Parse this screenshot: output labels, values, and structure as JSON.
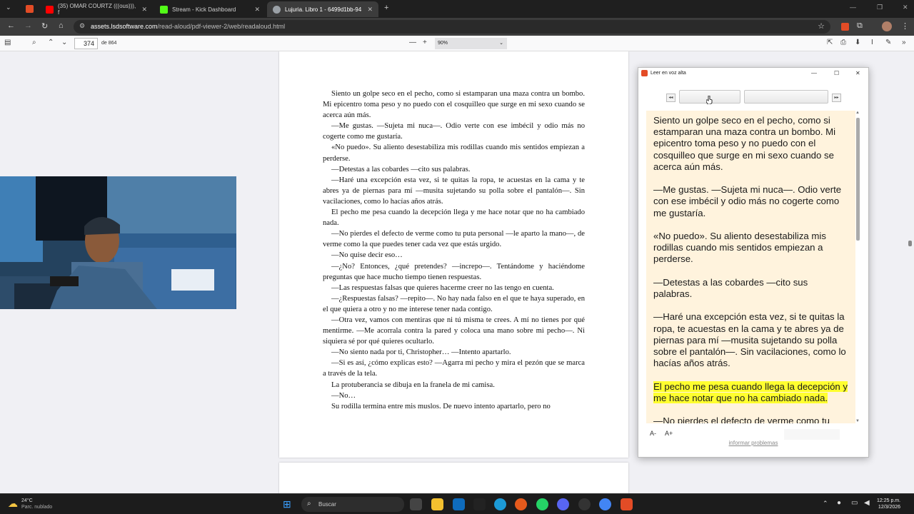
{
  "tabs": [
    {
      "label": "(35) OMAR COURTZ (((ous))), f",
      "color": "#ff0000"
    },
    {
      "label": "Stream - Kick Dashboard",
      "color": "#53fc18"
    },
    {
      "label": "Lujuria. Libro 1 - 6499d1bb-94",
      "color": "#9aa0a6"
    }
  ],
  "address": {
    "host": "assets.lsdsoftware.com",
    "path": "/read-aloud/pdf-viewer-2/web/readaloud.html"
  },
  "pdf_toolbar": {
    "page": "374",
    "page_count": "de 864",
    "zoom": "90%"
  },
  "page_paragraphs": [
    "Siento un golpe seco en el pecho, como si estamparan una maza contra un bombo. Mi epicentro toma peso y no puedo con el cosquilleo que surge en mi sexo cuando se acerca aún más.",
    "—Me gustas. —Sujeta mi nuca—. Odio verte con ese imbécil y odio más no cogerte como me gustaría.",
    "«No puedo». Su aliento desestabiliza mis rodillas cuando mis sentidos empiezan a perderse.",
    "—Detestas a las cobardes —cito sus palabras.",
    "—Haré una excepción esta vez, si te quitas la ropa, te acuestas en la cama y te abres ya de piernas para mí —musita sujetando su polla sobre el pantalón—. Sin vacilaciones, como lo hacías años atrás.",
    "El pecho me pesa cuando la decepción llega y me hace notar que no ha cambiado nada.",
    "—No pierdes el defecto de verme como tu puta personal —le aparto la mano—, de verme como la que puedes tener cada vez que estás urgido.",
    "—No quise decir eso…",
    "—¿No? Entonces, ¿qué pretendes? —increpo—. Tentándome y haciéndome preguntas que hace mucho tiempo tienen respuestas.",
    "—Las respuestas falsas que quieres hacerme creer no las tengo en cuenta.",
    "—¿Respuestas falsas? —repito—. No hay nada falso en el que te haya superado, en el que quiera a otro y no me interese tener nada contigo.",
    "—Otra vez, vamos con mentiras que ni tú misma te crees. A mí no tienes por qué mentirme. —Me acorrala contra la pared y coloca una mano sobre mi pecho—. Ni siquiera sé por qué quieres ocultarlo.",
    "—No siento nada por ti, Christopher… —Intento apartarlo.",
    "—Si es así, ¿cómo explicas esto? —Agarra mi pecho y mira el pezón que se marca a través de la tela.",
    "La protuberancia se dibuja en la franela de mi camisa.",
    "—No…",
    "Su rodilla termina entre mis muslos. De nuevo intento apartarlo, pero no"
  ],
  "read_aloud": {
    "title": "Leer en voz alta",
    "paragraphs": [
      "Siento un golpe seco en el pecho, como si estamparan una maza contra un bombo. Mi epicentro toma peso y no puedo con el cosquilleo que surge en mi sexo cuando se acerca aún más.",
      "—Me gustas. —Sujeta mi nuca—. Odio verte con ese imbécil y odio más no cogerte como me gustaría.",
      "«No puedo». Su aliento desestabiliza mis rodillas cuando mis sentidos empiezan a perderse.",
      "—Detestas a las cobardes —cito sus palabras.",
      "—Haré una excepción esta vez, si te quitas la ropa, te acuestas en la cama y te abres ya de piernas para mí —musita sujetando su polla sobre el pantalón—. Sin vacilaciones, como lo hacías años atrás.",
      "El pecho me pesa cuando llega la decepción y me hace notar que no ha cambiado nada.",
      "—No pierdes el defecto de verme como tu puta personal —le aparto la mano—, de"
    ],
    "highlight_index": 5,
    "font_down": "A-",
    "font_up": "A+",
    "report_link": "informar problemas",
    "highlight_color": "#ffff2f",
    "background_color": "#fff3dd"
  },
  "taskbar": {
    "temp": "24°C",
    "weather": "Parc. nublado",
    "search": "Buscar",
    "time": "12:25 p.m.",
    "date": "12/3/2026"
  }
}
